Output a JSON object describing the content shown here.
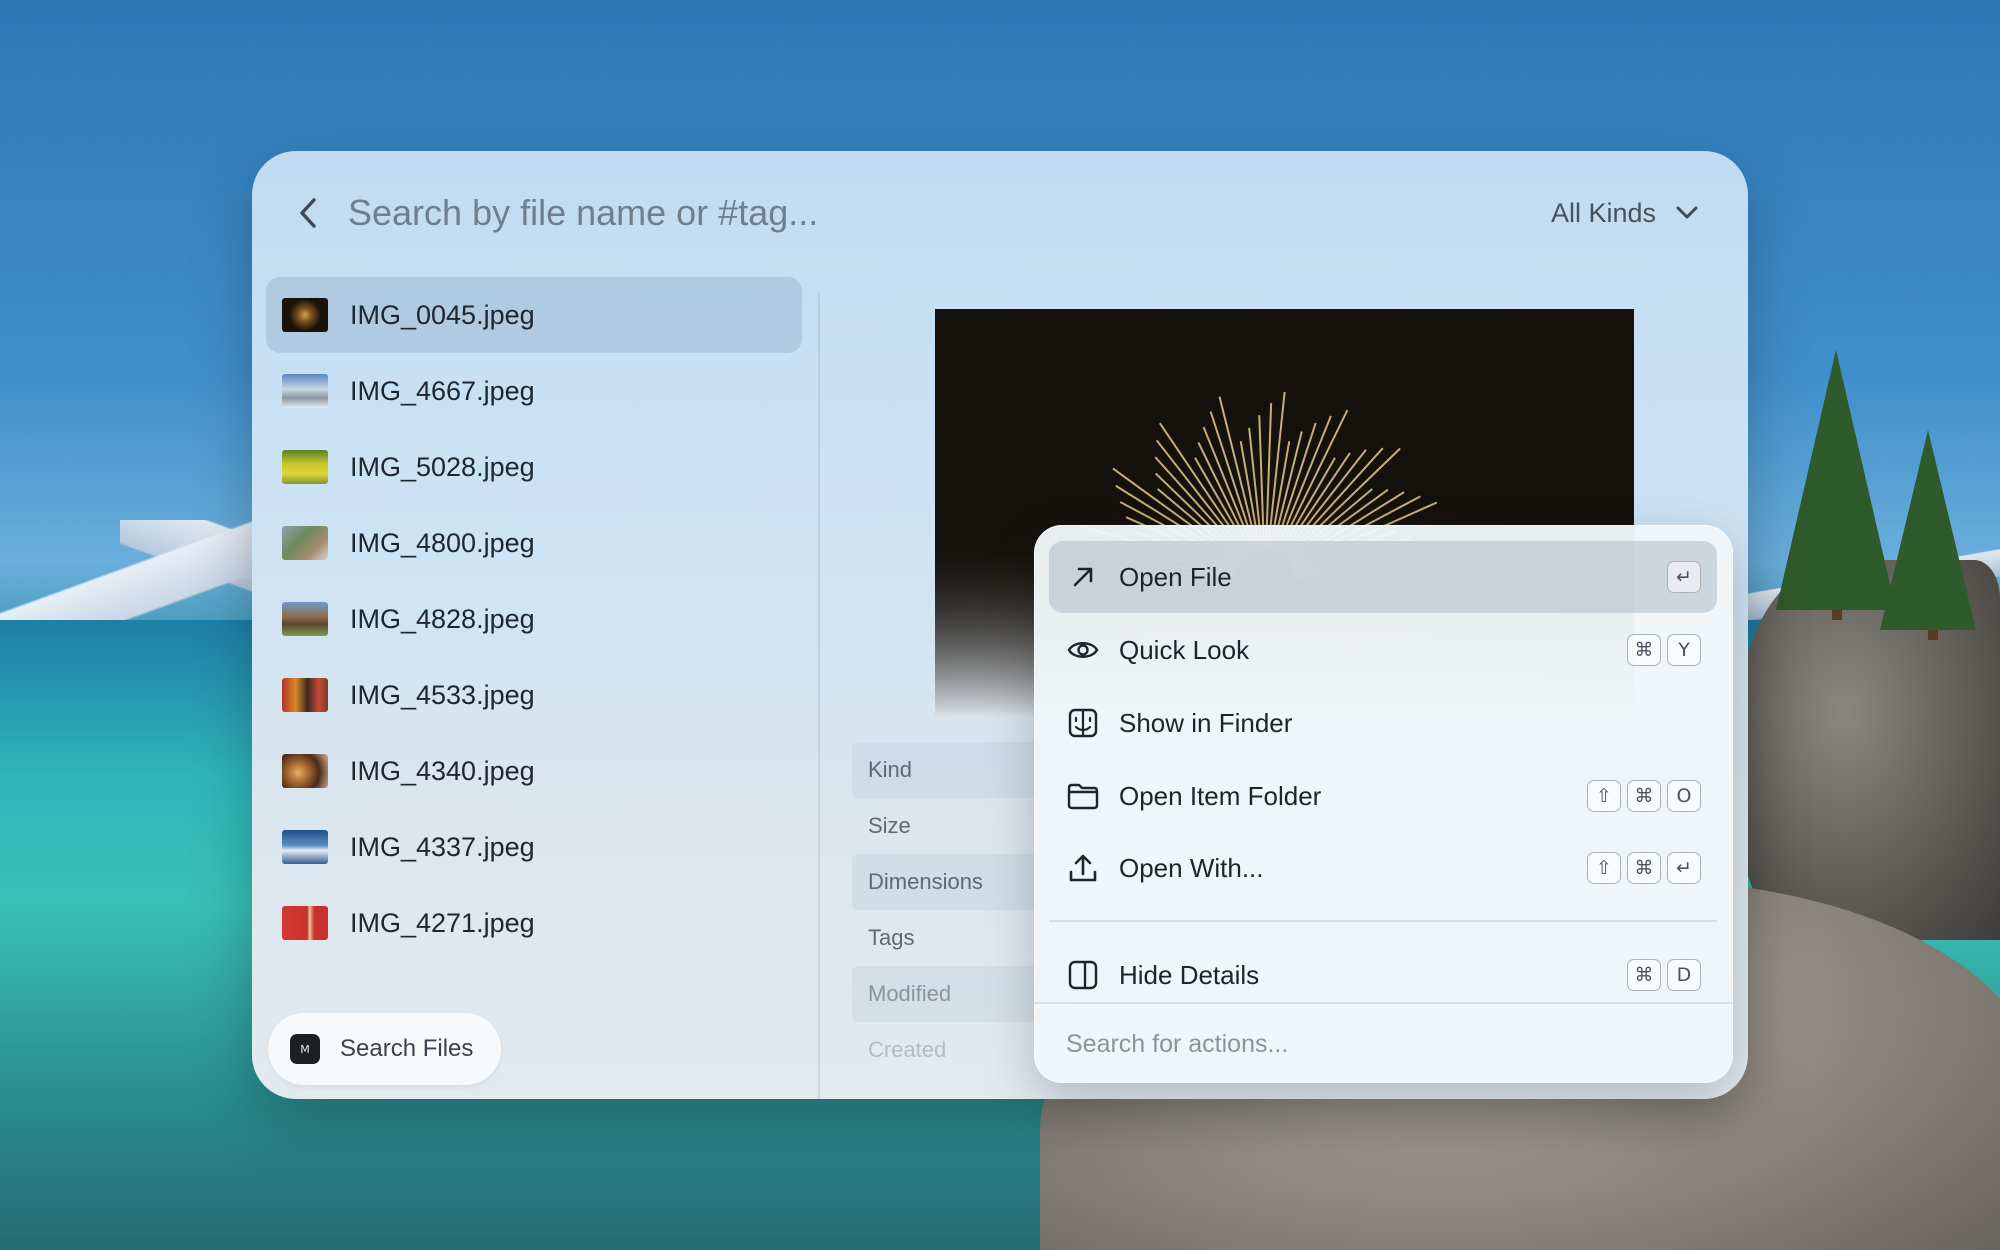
{
  "search": {
    "placeholder": "Search by file name or #tag...",
    "kind_filter": "All Kinds"
  },
  "files": [
    {
      "name": "IMG_0045.jpeg",
      "selected": true
    },
    {
      "name": "IMG_4667.jpeg",
      "selected": false
    },
    {
      "name": "IMG_5028.jpeg",
      "selected": false
    },
    {
      "name": "IMG_4800.jpeg",
      "selected": false
    },
    {
      "name": "IMG_4828.jpeg",
      "selected": false
    },
    {
      "name": "IMG_4533.jpeg",
      "selected": false
    },
    {
      "name": "IMG_4340.jpeg",
      "selected": false
    },
    {
      "name": "IMG_4337.jpeg",
      "selected": false
    },
    {
      "name": "IMG_4271.jpeg",
      "selected": false
    }
  ],
  "metadata_labels": [
    "Kind",
    "Size",
    "Dimensions",
    "Tags",
    "Modified",
    "Created"
  ],
  "launcher": {
    "label": "Search Files",
    "icon_glyph": "M"
  },
  "actions": [
    {
      "label": "Open File",
      "icon": "arrow-up-right-icon",
      "keys": [
        "↵"
      ],
      "selected": true
    },
    {
      "label": "Quick Look",
      "icon": "eye-icon",
      "keys": [
        "⌘",
        "Y"
      ],
      "selected": false
    },
    {
      "label": "Show in Finder",
      "icon": "finder-icon",
      "keys": [],
      "selected": false
    },
    {
      "label": "Open Item Folder",
      "icon": "folder-icon",
      "keys": [
        "⇧",
        "⌘",
        "O"
      ],
      "selected": false
    },
    {
      "label": "Open With...",
      "icon": "upload-icon",
      "keys": [
        "⇧",
        "⌘",
        "↵"
      ],
      "selected": false
    },
    {
      "label": "Hide Details",
      "icon": "sidebar-icon",
      "keys": [
        "⌘",
        "D"
      ],
      "selected": false
    }
  ],
  "action_search": {
    "placeholder": "Search for actions..."
  }
}
